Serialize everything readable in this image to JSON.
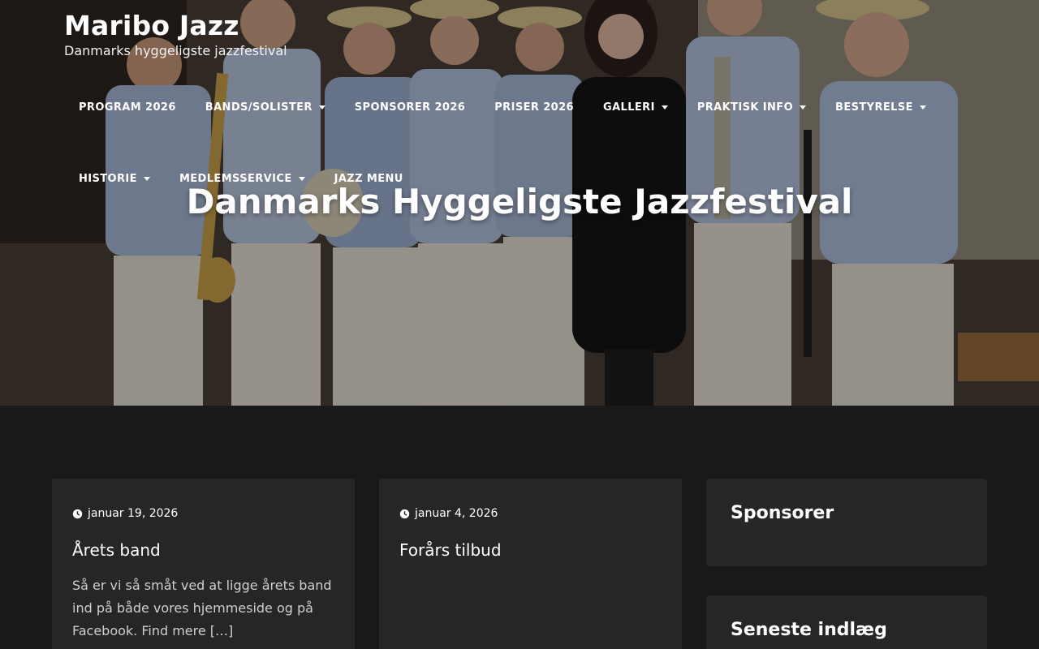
{
  "site": {
    "title": "Maribo Jazz",
    "tagline": "Danmarks hyggeligste jazzfestival"
  },
  "nav": {
    "row1": [
      {
        "label": "PROGRAM 2026",
        "dropdown": false
      },
      {
        "label": "BANDS/SOLISTER",
        "dropdown": true
      },
      {
        "label": "SPONSORER 2026",
        "dropdown": false
      },
      {
        "label": "PRISER 2026",
        "dropdown": false
      },
      {
        "label": "GALLERI",
        "dropdown": true
      },
      {
        "label": "PRAKTISK INFO",
        "dropdown": true
      },
      {
        "label": "BESTYRELSE",
        "dropdown": true
      }
    ],
    "row2": [
      {
        "label": "HISTORIE",
        "dropdown": true
      },
      {
        "label": "MEDLEMSSERVICE",
        "dropdown": true
      },
      {
        "label": "JAZZ MENU",
        "dropdown": false
      }
    ]
  },
  "hero": {
    "heading": "Danmarks Hyggeligste Jazzfestival"
  },
  "posts": [
    {
      "date": "januar 19, 2026",
      "title": "Årets band",
      "excerpt": "Så er vi så småt ved at ligge årets band ind på både vores hjemmeside og på Facebook. Find mere […]"
    },
    {
      "date": "januar 4, 2026",
      "title": "Forårs tilbud",
      "excerpt": ""
    }
  ],
  "sidebar": {
    "sponsors_title": "Sponsorer",
    "recent_title": "Seneste indlæg"
  },
  "colors": {
    "page_background": "#191919",
    "card_background": "#262626",
    "text": "#ffffff"
  }
}
